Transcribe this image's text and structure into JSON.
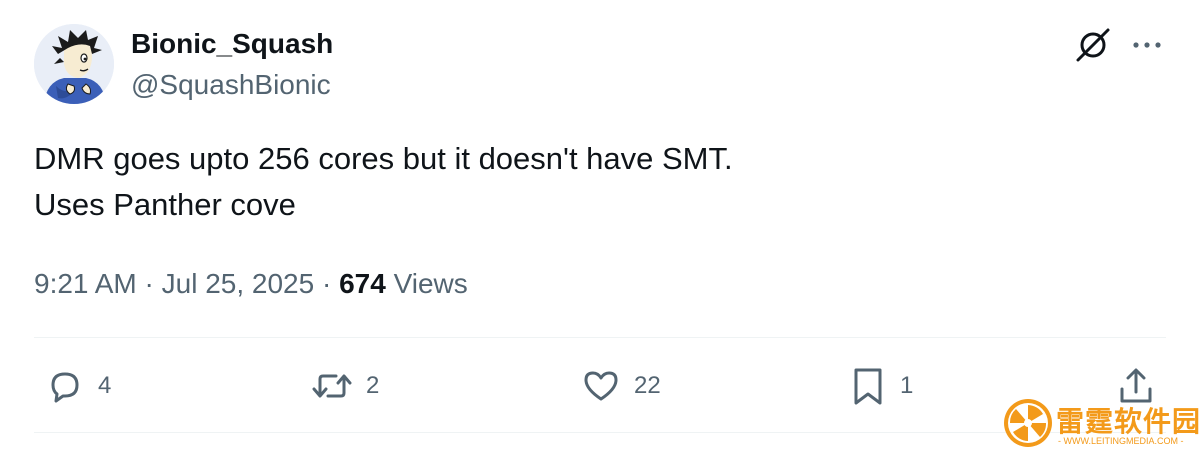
{
  "author": {
    "display_name": "Bionic_Squash",
    "handle": "@SquashBionic"
  },
  "header_icons": {
    "grok": "grok-icon",
    "more": "more-dots-icon"
  },
  "tweet": {
    "lines": [
      "DMR goes upto 256 cores but it doesn't have SMT.",
      "Uses Panther cove"
    ]
  },
  "meta": {
    "time": "9:21 AM",
    "separator": "·",
    "date": "Jul 25, 2025",
    "views_count": "674",
    "views_label": "Views"
  },
  "actions": {
    "replies": "4",
    "reposts": "2",
    "likes": "22",
    "bookmarks": "1"
  },
  "watermark": {
    "name": "雷霆软件园",
    "url": "- WWW.LEITINGMEDIA.COM -"
  },
  "colors": {
    "text_primary": "#0f1419",
    "text_secondary": "#536471",
    "divider": "#eff3f4",
    "watermark": "#f39a1a"
  }
}
